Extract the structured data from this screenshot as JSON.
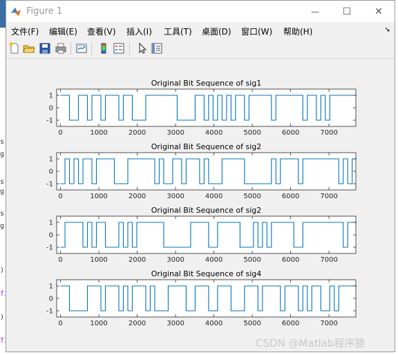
{
  "window": {
    "title": "Figure 1",
    "controls": {
      "minimize": "—",
      "maximize": "☐",
      "close": "✕"
    }
  },
  "menu": [
    {
      "label": "文件(F)"
    },
    {
      "label": "编辑(E)"
    },
    {
      "label": "查看(V)"
    },
    {
      "label": "插入(I)"
    },
    {
      "label": "工具(T)"
    },
    {
      "label": "桌面(D)"
    },
    {
      "label": "窗口(W)"
    },
    {
      "label": "帮助(H)"
    }
  ],
  "menu_overflow_icon": "dock-arrow-icon",
  "toolbar": [
    {
      "name": "new-figure-icon"
    },
    {
      "name": "open-file-icon"
    },
    {
      "name": "save-icon"
    },
    {
      "name": "print-icon"
    },
    {
      "name": "link-plot-icon"
    },
    {
      "name": "colorbar-icon"
    },
    {
      "name": "legend-icon"
    },
    {
      "name": "edit-plot-icon"
    },
    {
      "name": "property-inspector-icon"
    }
  ],
  "colors": {
    "line": "#0072bd",
    "axes": "#262626",
    "figure_bg": "#f0f0f0",
    "axes_bg": "#ffffff"
  },
  "background_editor_fragments": [
    "s",
    "g",
    "s",
    "g",
    "s",
    "g",
    ")",
    "fi",
    ")",
    "fi"
  ],
  "watermark": "CSDN @Matlab程序猿",
  "chart_data": [
    {
      "type": "line",
      "title": "Original Bit Sequence of sig1",
      "xlim": [
        -100,
        7700
      ],
      "ylim": [
        -1.5,
        1.5
      ],
      "xticks": [
        0,
        1000,
        2000,
        3000,
        4000,
        5000,
        6000,
        7000
      ],
      "yticks": [
        1,
        0,
        -1
      ],
      "series": [
        {
          "values": [
            1,
            1,
            -1,
            -1,
            1,
            1,
            -1,
            1,
            1,
            -1,
            1,
            1,
            1,
            -1,
            1,
            1,
            -1,
            -1,
            -1,
            1,
            1,
            1,
            1,
            1,
            1,
            1,
            -1,
            -1,
            -1,
            -1,
            1,
            1,
            -1,
            1,
            -1,
            1,
            -1,
            1,
            -1,
            1,
            1,
            -1,
            1,
            1,
            1,
            1,
            1,
            -1,
            1,
            1,
            1,
            1,
            1,
            1,
            -1,
            1,
            1,
            -1,
            1,
            -1,
            1,
            1,
            1,
            1,
            1,
            1
          ],
          "step": 117
        }
      ]
    },
    {
      "type": "line",
      "title": "Original Bit Sequence of sig2",
      "xlim": [
        -100,
        7700
      ],
      "ylim": [
        -1.5,
        1.5
      ],
      "xticks": [
        0,
        1000,
        2000,
        3000,
        4000,
        5000,
        6000,
        7000
      ],
      "yticks": [
        1,
        0,
        -1
      ],
      "series": [
        {
          "values": [
            -1,
            1,
            -1,
            1,
            -1,
            1,
            1,
            -1,
            1,
            1,
            1,
            1,
            -1,
            -1,
            -1,
            1,
            1,
            1,
            1,
            1,
            1,
            -1,
            1,
            -1,
            -1,
            1,
            1,
            -1,
            1,
            1,
            1,
            -1,
            1,
            -1,
            -1,
            -1,
            1,
            1,
            1,
            1,
            1,
            -1,
            -1,
            -1,
            -1,
            -1,
            -1,
            1,
            -1,
            1,
            1,
            1,
            1,
            -1,
            1,
            1,
            1,
            1,
            1,
            1,
            1,
            1,
            -1,
            1,
            -1,
            1
          ],
          "step": 117
        }
      ]
    },
    {
      "type": "line",
      "title": "Original Bit Sequence of sig2",
      "xlim": [
        -100,
        7700
      ],
      "ylim": [
        -1.5,
        1.5
      ],
      "xticks": [
        0,
        1000,
        2000,
        3000,
        4000,
        5000,
        6000,
        7000
      ],
      "yticks": [
        1,
        0,
        -1
      ],
      "series": [
        {
          "values": [
            -1,
            1,
            1,
            1,
            1,
            -1,
            1,
            -1,
            1,
            1,
            -1,
            -1,
            -1,
            1,
            -1,
            1,
            -1,
            1,
            1,
            1,
            1,
            1,
            1,
            -1,
            -1,
            -1,
            -1,
            -1,
            -1,
            1,
            1,
            1,
            1,
            -1,
            -1,
            1,
            1,
            1,
            1,
            1,
            -1,
            -1,
            -1,
            1,
            -1,
            1,
            -1,
            1,
            1,
            1,
            1,
            1,
            -1,
            -1,
            1,
            1,
            1,
            1,
            1,
            1,
            1,
            1,
            1,
            -1,
            1,
            1
          ],
          "step": 117
        }
      ]
    },
    {
      "type": "line",
      "title": "Original Bit Sequence of sig4",
      "xlim": [
        -100,
        7700
      ],
      "ylim": [
        -1.5,
        1.5
      ],
      "xticks": [
        0,
        1000,
        2000,
        3000,
        4000,
        5000,
        6000,
        7000
      ],
      "yticks": [
        1,
        0,
        -1
      ],
      "series": [
        {
          "values": [
            1,
            1,
            -1,
            -1,
            -1,
            -1,
            1,
            1,
            1,
            -1,
            1,
            1,
            1,
            -1,
            1,
            -1,
            1,
            1,
            1,
            -1,
            1,
            -1,
            -1,
            -1,
            1,
            1,
            1,
            1,
            -1,
            -1,
            1,
            1,
            1,
            -1,
            -1,
            1,
            1,
            1,
            -1,
            -1,
            -1,
            1,
            1,
            1,
            -1,
            1,
            1,
            1,
            1,
            -1,
            1,
            1,
            1,
            -1,
            1,
            -1,
            1,
            1,
            -1,
            -1,
            1,
            -1,
            1,
            1,
            1,
            1
          ],
          "step": 117
        }
      ]
    }
  ]
}
